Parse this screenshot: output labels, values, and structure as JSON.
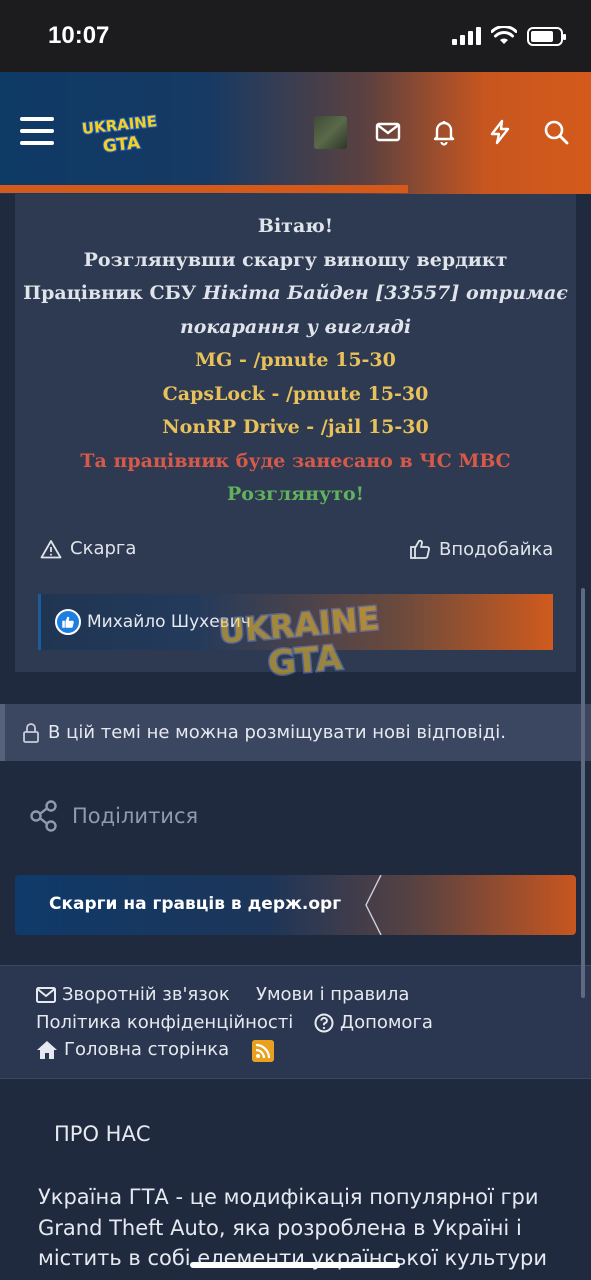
{
  "status_bar": {
    "time": "10:07",
    "battery_level": 0.8
  },
  "header": {
    "logo_line1": "UKRAINE",
    "logo_line2": "GTA",
    "icons": [
      "menu-icon",
      "mail-icon",
      "bell-icon",
      "lightning-icon",
      "search-icon"
    ]
  },
  "post": {
    "line1": "Вітаю!",
    "line2": "Розглянувши скаргу виношу вердикт",
    "line3_start": "Працівник СБУ ",
    "line3_italic": "Нікіта Байден [33557] отримає",
    "line4_italic": "покарання у вигляді",
    "punish1": "MG - /pmute 15-30",
    "punish2": "CapsLock - /pmute 15-30",
    "punish3": "NonRP Drive - /jail 15-30",
    "blacklist": "Та працівник буде занесано в ЧС МВС",
    "status": "Розглянуто!",
    "report_label": "Скарга",
    "like_label": "Вподобайка",
    "liked_by": "Михайло Шухевич"
  },
  "watermark": {
    "line1": "UKRAINE",
    "line2": "GTA"
  },
  "thread_notice": "В цій темі не можна розміщувати нові відповіді.",
  "share_label": "Поділитися",
  "breadcrumb": "Скарги на гравців в держ.орг",
  "footer": {
    "contact": "Зворотній зв'язок",
    "terms": "Умови і правила",
    "privacy": "Політика конфіденційності",
    "help": "Допомога",
    "home": "Головна сторінка"
  },
  "about": {
    "title": "ПРО НАС",
    "text": "Україна ГТА - це модифікація популярної гри Grand Theft Auto, яка розроблена в Україні і містить в собі елементи української культури"
  },
  "colors": {
    "accent_orange": "#d45a1b",
    "header_blue": "#0e3a66",
    "card_bg": "#2e3a52",
    "yellow": "#e8c15a",
    "red": "#d65a4a",
    "green": "#62b25d"
  }
}
